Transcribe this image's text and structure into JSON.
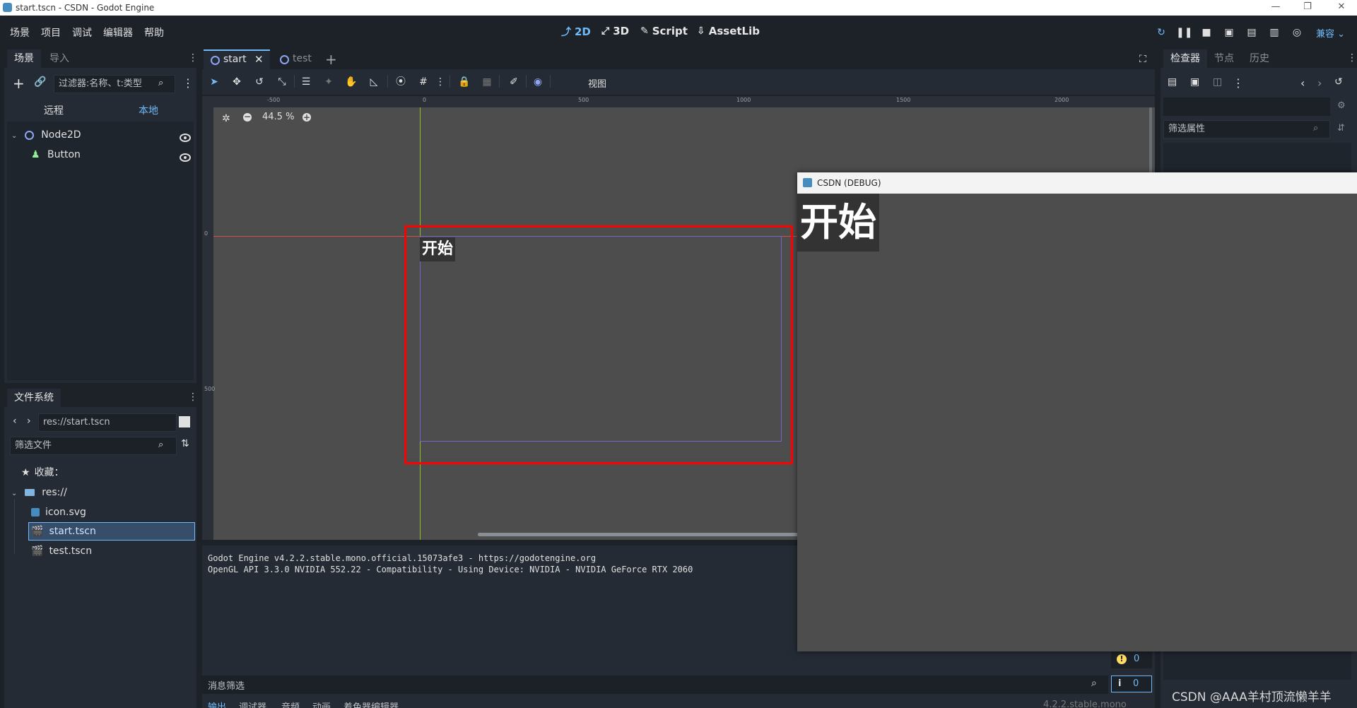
{
  "window": {
    "title": "start.tscn - CSDN - Godot Engine"
  },
  "menu": [
    "场景",
    "项目",
    "调试",
    "编辑器",
    "帮助"
  ],
  "workspaces": [
    {
      "label": "2D",
      "icon": "2d-icon",
      "active": true
    },
    {
      "label": "3D",
      "icon": "3d-icon",
      "active": false
    },
    {
      "label": "Script",
      "icon": "script-icon",
      "active": false
    },
    {
      "label": "AssetLib",
      "icon": "assetlib-icon",
      "active": false
    }
  ],
  "renderer": "兼容",
  "scene_dock": {
    "tabs": [
      "场景",
      "导入"
    ],
    "filter_placeholder": "过滤器:名称、t:类型",
    "remote_label": "远程",
    "local_label": "本地",
    "nodes": [
      {
        "name": "Node2D",
        "type": "node2d"
      },
      {
        "name": "Button",
        "type": "button"
      }
    ]
  },
  "filesystem": {
    "title": "文件系统",
    "path": "res://start.tscn",
    "filter_placeholder": "筛选文件",
    "favorites": "收藏：",
    "root": "res://",
    "files": [
      {
        "name": "icon.svg",
        "selected": false
      },
      {
        "name": "start.tscn",
        "selected": true
      },
      {
        "name": "test.tscn",
        "selected": false
      }
    ]
  },
  "editor": {
    "tabs": [
      {
        "label": "start",
        "active": true
      },
      {
        "label": "test",
        "active": false
      }
    ],
    "view_label": "视图",
    "zoom": "44.5 %",
    "ruler_labels_x": [
      "-500",
      "0",
      "500",
      "1000",
      "1500",
      "2000"
    ],
    "ruler_labels_y": [
      "0",
      "500"
    ],
    "button_text": "开始"
  },
  "console": {
    "lines": [
      "Godot Engine v4.2.2.stable.mono.official.15073afe3 - https://godotengine.org",
      "OpenGL API 3.3.0 NVIDIA 552.22 - Compatibility - Using Device: NVIDIA - NVIDIA GeForce RTX 2060"
    ],
    "filter_placeholder": "消息筛选",
    "warning_count": "0",
    "info_count": "0",
    "bottom_tabs": [
      "输出",
      "调试器",
      "音频",
      "动画",
      "着色器编辑器"
    ],
    "version": "4.2.2.stable.mono"
  },
  "inspector": {
    "tabs": [
      "检查器",
      "节点",
      "历史"
    ],
    "filter_placeholder": "筛选属性"
  },
  "debug_window": {
    "title": "CSDN (DEBUG)",
    "button_text": "开始"
  },
  "watermark": "CSDN @AAA羊村顶流懒羊羊",
  "colors": {
    "accent": "#70bafa",
    "selection": "#ff0000",
    "viewport": "#4d4d4d",
    "panel": "#252b34"
  }
}
